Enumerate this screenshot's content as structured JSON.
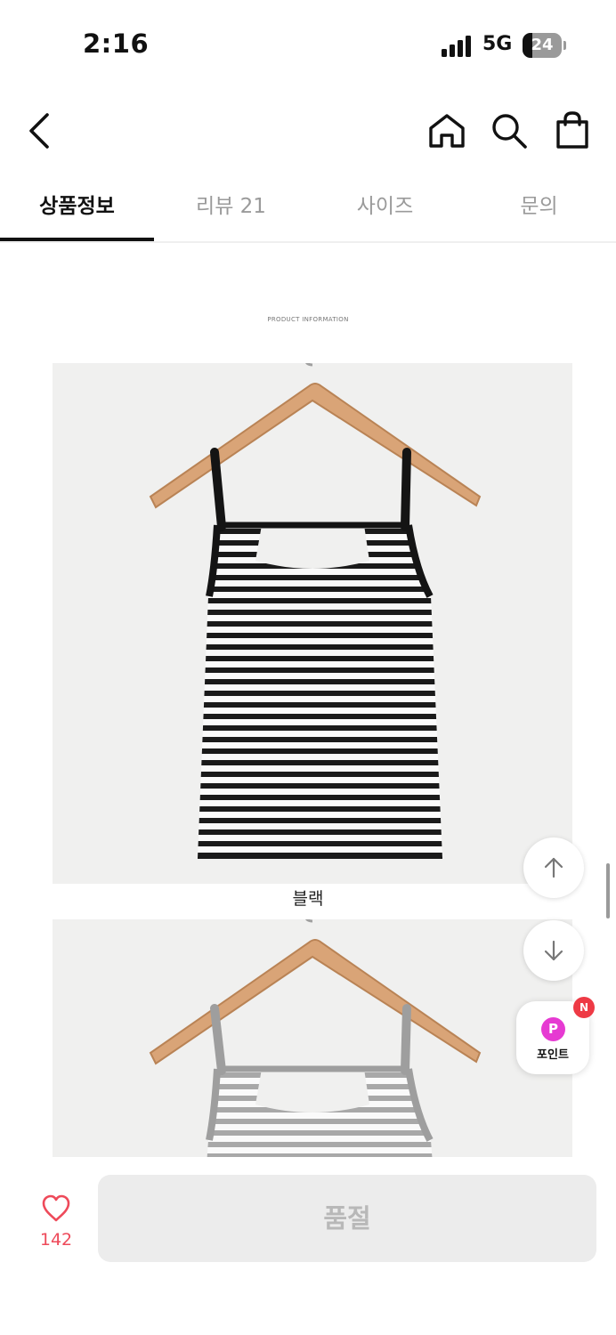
{
  "status_bar": {
    "time": "2:16",
    "network": "5G",
    "battery": "24",
    "battery_level_percent": 24
  },
  "top_nav": {
    "back_icon": "chevron-left-icon",
    "home_icon": "home-icon",
    "search_icon": "search-icon",
    "cart_icon": "shopping-bag-icon"
  },
  "tabs": [
    {
      "label": "상품정보",
      "active": true
    },
    {
      "label": "리뷰 21",
      "active": false
    },
    {
      "label": "사이즈",
      "active": false
    },
    {
      "label": "문의",
      "active": false
    }
  ],
  "content": {
    "header_label": "PRODUCT INFORMATION",
    "items": [
      {
        "color_name": "블랙",
        "trim_color": "#141414"
      },
      {
        "color_name": "",
        "trim_color": "#9e9e9e"
      }
    ]
  },
  "floating": {
    "scroll_up_icon": "arrow-up-icon",
    "scroll_down_icon": "arrow-down-icon",
    "point_letter": "P",
    "point_label": "포인트",
    "new_badge": "N"
  },
  "bottom_bar": {
    "like_icon": "heart-icon",
    "like_count": "142",
    "action_label": "품절",
    "like_color": "#ee4a5a"
  }
}
